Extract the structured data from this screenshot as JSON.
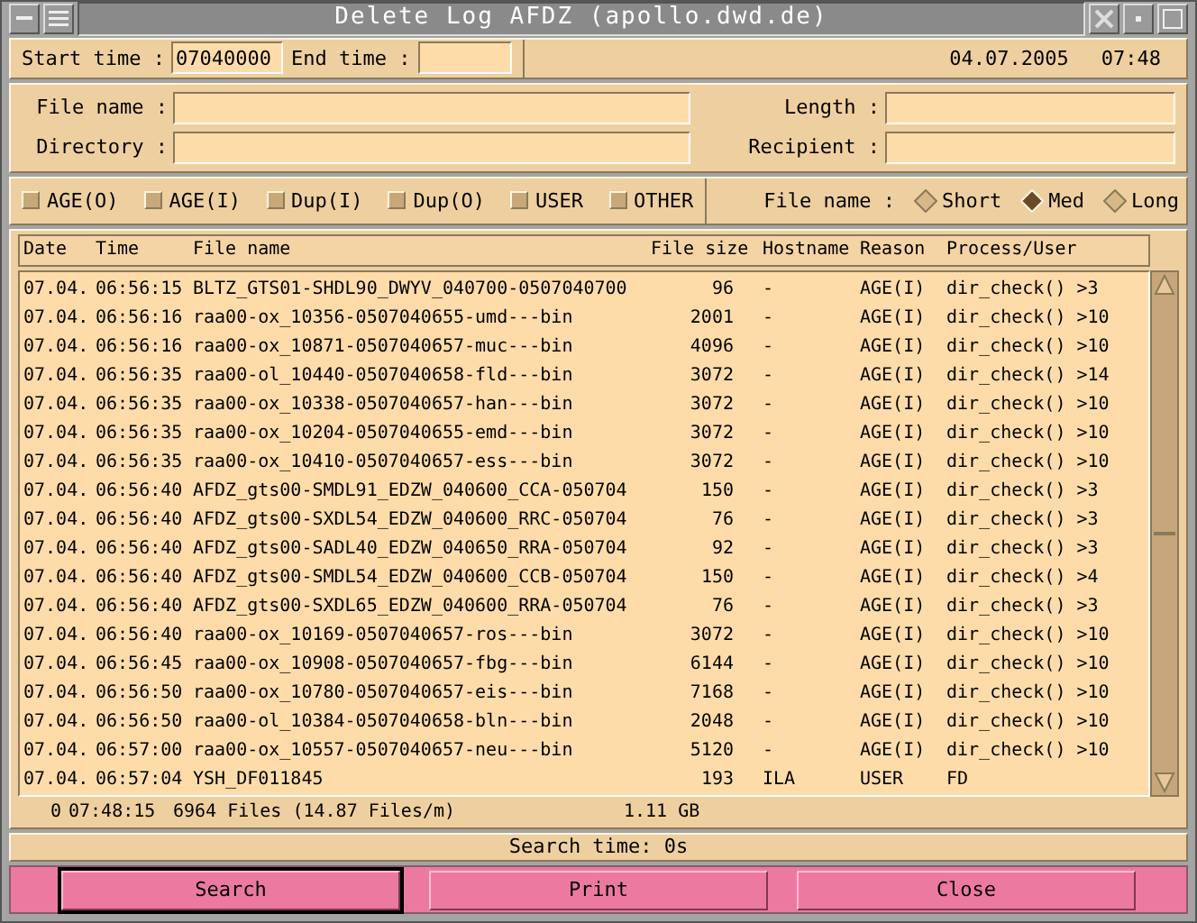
{
  "window": {
    "title": "Delete Log AFDZ (apollo.dwd.de)"
  },
  "time_filter": {
    "start_label": "Start time :",
    "start_value": "07040000",
    "end_label": "End time :",
    "date": "04.07.2005",
    "time": "07:48"
  },
  "fields": [
    {
      "label": "File name :"
    },
    {
      "label": "Length :"
    },
    {
      "label": "Directory :"
    },
    {
      "label": "Recipient :"
    }
  ],
  "reasons": [
    {
      "label": "AGE(O)",
      "checked": false
    },
    {
      "label": "AGE(I)",
      "checked": false
    },
    {
      "label": "Dup(I)",
      "checked": false
    },
    {
      "label": "Dup(O)",
      "checked": false
    },
    {
      "label": "USER",
      "checked": false
    },
    {
      "label": "OTHER",
      "checked": false
    }
  ],
  "file_name_mode": {
    "label": "File name :",
    "options": [
      {
        "label": "Short",
        "selected": false
      },
      {
        "label": "Med",
        "selected": true
      },
      {
        "label": "Long",
        "selected": false
      }
    ]
  },
  "table": {
    "columns": [
      "Date",
      "Time",
      "File name",
      "File size",
      "Hostname",
      "Reason",
      "Process/User"
    ],
    "rows": [
      [
        "07.04.",
        "06:56:15",
        "BLTZ_GTS01-SHDL90_DWYV_040700-0507040700",
        "96",
        "-",
        "AGE(I)",
        "dir_check() >3"
      ],
      [
        "07.04.",
        "06:56:16",
        "raa00-ox_10356-0507040655-umd---bin",
        "2001",
        "-",
        "AGE(I)",
        "dir_check() >10"
      ],
      [
        "07.04.",
        "06:56:16",
        "raa00-ox_10871-0507040657-muc---bin",
        "4096",
        "-",
        "AGE(I)",
        "dir_check() >10"
      ],
      [
        "07.04.",
        "06:56:35",
        "raa00-ol_10440-0507040658-fld---bin",
        "3072",
        "-",
        "AGE(I)",
        "dir_check() >14"
      ],
      [
        "07.04.",
        "06:56:35",
        "raa00-ox_10338-0507040657-han---bin",
        "3072",
        "-",
        "AGE(I)",
        "dir_check() >10"
      ],
      [
        "07.04.",
        "06:56:35",
        "raa00-ox_10204-0507040655-emd---bin",
        "3072",
        "-",
        "AGE(I)",
        "dir_check() >10"
      ],
      [
        "07.04.",
        "06:56:35",
        "raa00-ox_10410-0507040657-ess---bin",
        "3072",
        "-",
        "AGE(I)",
        "dir_check() >10"
      ],
      [
        "07.04.",
        "06:56:40",
        "AFDZ_gts00-SMDL91_EDZW_040600_CCA-050704",
        "150",
        "-",
        "AGE(I)",
        "dir_check() >3"
      ],
      [
        "07.04.",
        "06:56:40",
        "AFDZ_gts00-SXDL54_EDZW_040600_RRC-050704",
        "76",
        "-",
        "AGE(I)",
        "dir_check() >3"
      ],
      [
        "07.04.",
        "06:56:40",
        "AFDZ_gts00-SADL40_EDZW_040650_RRA-050704",
        "92",
        "-",
        "AGE(I)",
        "dir_check() >3"
      ],
      [
        "07.04.",
        "06:56:40",
        "AFDZ_gts00-SMDL54_EDZW_040600_CCB-050704",
        "150",
        "-",
        "AGE(I)",
        "dir_check() >4"
      ],
      [
        "07.04.",
        "06:56:40",
        "AFDZ_gts00-SXDL65_EDZW_040600_RRA-050704",
        "76",
        "-",
        "AGE(I)",
        "dir_check() >3"
      ],
      [
        "07.04.",
        "06:56:40",
        "raa00-ox_10169-0507040657-ros---bin",
        "3072",
        "-",
        "AGE(I)",
        "dir_check() >10"
      ],
      [
        "07.04.",
        "06:56:45",
        "raa00-ox_10908-0507040657-fbg---bin",
        "6144",
        "-",
        "AGE(I)",
        "dir_check() >10"
      ],
      [
        "07.04.",
        "06:56:50",
        "raa00-ox_10780-0507040657-eis---bin",
        "7168",
        "-",
        "AGE(I)",
        "dir_check() >10"
      ],
      [
        "07.04.",
        "06:56:50",
        "raa00-ol_10384-0507040658-bln---bin",
        "2048",
        "-",
        "AGE(I)",
        "dir_check() >10"
      ],
      [
        "07.04.",
        "06:57:00",
        "raa00-ox_10557-0507040657-neu---bin",
        "5120",
        "-",
        "AGE(I)",
        "dir_check() >10"
      ],
      [
        "07.04.",
        "06:57:04",
        "YSH_DF011845",
        "193",
        "ILA",
        "USER",
        "FD"
      ]
    ]
  },
  "summary": {
    "count": "0",
    "time": "07:48:15",
    "files": "6964 Files (14.87 Files/m)",
    "size": "1.11 GB"
  },
  "search_time": "Search time: 0s",
  "buttons": [
    {
      "label": "Search",
      "selected": true
    },
    {
      "label": "Print",
      "selected": false
    },
    {
      "label": "Close",
      "selected": false
    }
  ]
}
